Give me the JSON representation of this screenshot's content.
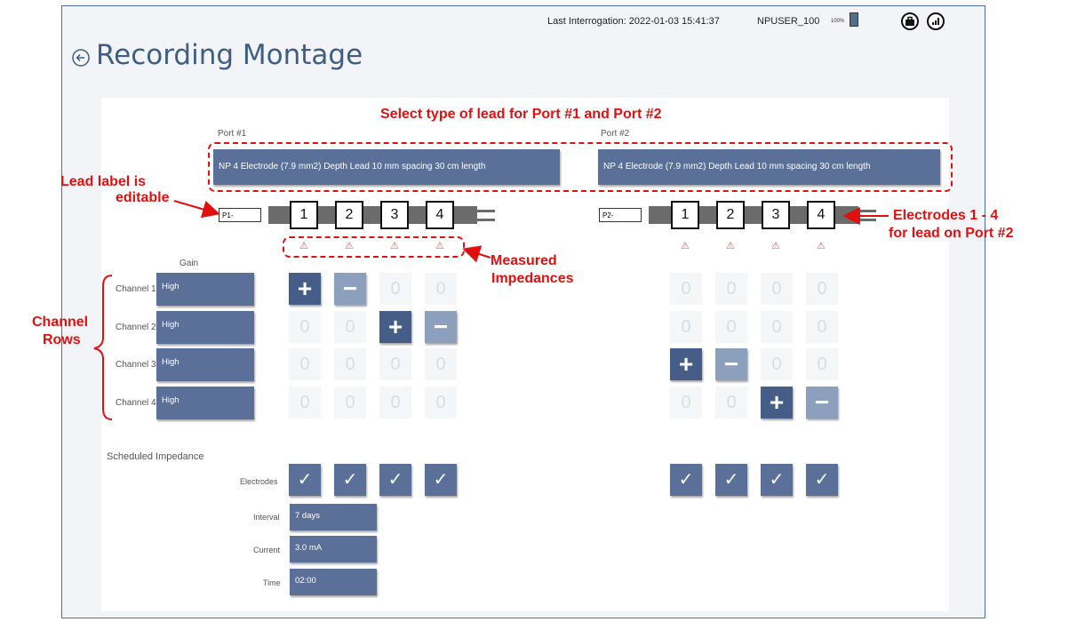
{
  "header": {
    "last_interrogation": "Last Interrogation: 2022-01-03 15:41:37",
    "user": "NPUSER_100",
    "battery_pct": "100%",
    "icons": [
      "toolbox-icon",
      "signal-icon"
    ]
  },
  "page_title": "Recording Montage",
  "ports": [
    {
      "label": "Port #1",
      "lead_type": "NP 4 Electrode (7.9 mm2) Depth Lead 10 mm spacing 30 cm length",
      "lead_label": "P1-",
      "electrodes": [
        "1",
        "2",
        "3",
        "4"
      ]
    },
    {
      "label": "Port #2",
      "lead_type": "NP 4 Electrode (7.9 mm2) Depth Lead 10 mm spacing 30 cm length",
      "lead_label": "P2-",
      "electrodes": [
        "1",
        "2",
        "3",
        "4"
      ]
    }
  ],
  "gain_header": "Gain",
  "channels": [
    {
      "label": "Channel 1",
      "gain": "High",
      "p1": [
        "+",
        "−",
        "0",
        "0"
      ],
      "p2": [
        "0",
        "0",
        "0",
        "0"
      ]
    },
    {
      "label": "Channel 2",
      "gain": "High",
      "p1": [
        "0",
        "0",
        "+",
        "−"
      ],
      "p2": [
        "0",
        "0",
        "0",
        "0"
      ]
    },
    {
      "label": "Channel 3",
      "gain": "High",
      "p1": [
        "0",
        "0",
        "0",
        "0"
      ],
      "p2": [
        "+",
        "−",
        "0",
        "0"
      ]
    },
    {
      "label": "Channel 4",
      "gain": "High",
      "p1": [
        "0",
        "0",
        "0",
        "0"
      ],
      "p2": [
        "0",
        "0",
        "+",
        "−"
      ]
    }
  ],
  "scheduled_impedance": {
    "title": "Scheduled Impedance",
    "electrodes_label": "Electrodes",
    "interval_label": "Interval",
    "interval_value": "7 days",
    "current_label": "Current",
    "current_value": "3.0 mA",
    "time_label": "Time",
    "time_value": "02:00"
  },
  "annotations": {
    "select_type": "Select type of lead for Port #1 and Port #2",
    "lead_label_line1": "Lead label is",
    "lead_label_line2": "editable",
    "electrodes_line1": "Electrodes 1 - 4",
    "electrodes_line2": "for lead on Port #2",
    "impedances_line1": "Measured",
    "impedances_line2": "Impedances",
    "channel_rows_line1": "Channel",
    "channel_rows_line2": "Rows"
  },
  "colors": {
    "annotation": "#e01010",
    "button": "#5a7098",
    "title": "#3e5e85"
  }
}
